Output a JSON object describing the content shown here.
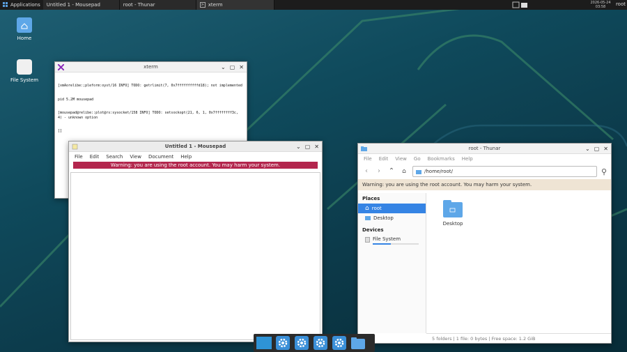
{
  "panel": {
    "applications_label": "Applications",
    "tasks": [
      "Untitled 1 - Mousepad",
      "root - Thunar",
      "xterm"
    ],
    "clock_date": "2026-05-24",
    "clock_time": "03:58",
    "user": "root"
  },
  "desktop": {
    "icons": [
      {
        "label": "Home",
        "icon": "home-folder-icon"
      },
      {
        "label": "File System",
        "icon": "drive-icon"
      }
    ]
  },
  "xterm": {
    "title": "xterm",
    "lines": [
      "[xmAorelibe:;pleform:oyst/16 INFO] TODO: getrlimit(7, 0x7ffffffffffd18); not implemented",
      "pid 5.2M mousepad",
      "[mousepad@relibe::plot@rs:sysocket/158 INFO] TODO: setsockopt(21, 6, 1, 0x7ffffffff3c, 4) - unknown option",
      "[]"
    ]
  },
  "mousepad": {
    "title": "Untitled 1 - Mousepad",
    "menu": [
      "File",
      "Edit",
      "Search",
      "View",
      "Document",
      "Help"
    ],
    "warning": "Warning: you are using the root account. You may harm your system."
  },
  "thunar": {
    "title": "root - Thunar",
    "menu": [
      "File",
      "Edit",
      "View",
      "Go",
      "Bookmarks",
      "Help"
    ],
    "address": "/home/root/",
    "warning": "Warning: you are using the root account. You may harm your system.",
    "places_header": "Places",
    "places": [
      "root",
      "Desktop"
    ],
    "devices_header": "Devices",
    "devices": [
      "File System"
    ],
    "files": [
      "Desktop"
    ],
    "status": "5 folders  |  1 file: 0 bytes  |  Free space: 1.2 GiB"
  },
  "colors": {
    "accent": "#3584e4",
    "warning_red": "#b3264d",
    "panel": "#1c1c1c"
  }
}
